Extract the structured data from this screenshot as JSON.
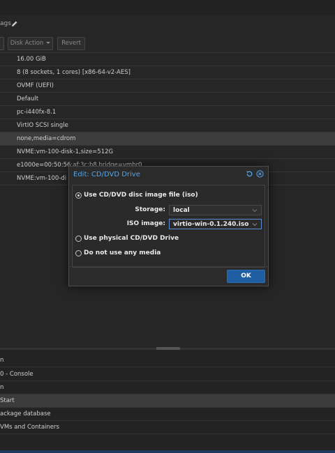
{
  "header": {
    "tags_fragment": "ags"
  },
  "toolbar": {
    "disk_action_label": "Disk Action",
    "revert_label": "Revert"
  },
  "hardware_rows": [
    "16.00 GiB",
    "8 (8 sockets, 1 cores) [x86-64-v2-AES]",
    "OVMF (UEFI)",
    "Default",
    "pc-i440fx-8.1",
    "VirtIO SCSI single",
    "none,media=cdrom",
    "NVME:vm-100-disk-1,size=512G",
    "e1000e=00:50:56:af:3c:b8,bridge=vmbr0",
    "NVME:vm-100-di"
  ],
  "selected_row_index": 6,
  "tasks": {
    "header_fragment": "n",
    "rows": [
      "0 - Console",
      "n",
      "Start",
      "ackage database",
      "VMs and Containers"
    ],
    "selected_index": 2
  },
  "dialog": {
    "title": "Edit: CD/DVD Drive",
    "options": {
      "iso_label": "Use CD/DVD disc image file (iso)",
      "physical_label": "Use physical CD/DVD Drive",
      "none_label": "Do not use any media"
    },
    "selected_option": "iso",
    "storage": {
      "label": "Storage:",
      "value": "local"
    },
    "iso_image": {
      "label": "ISO image:",
      "value": "virtio-win-0.1.240.iso"
    },
    "ok_label": "OK"
  },
  "colors": {
    "accent": "#57a5e8",
    "ok_button": "#1f5ea3",
    "background": "#262626"
  },
  "icons": {
    "edit": "pencil-icon",
    "reset": "reset-icon",
    "close": "close-icon",
    "dropdown": "chevron-down-icon"
  }
}
